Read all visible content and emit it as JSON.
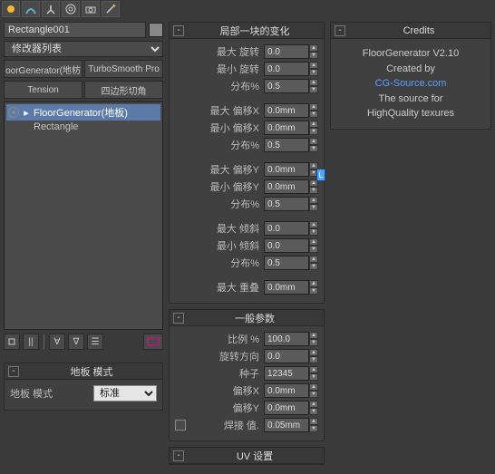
{
  "left": {
    "object_name": "Rectangle001",
    "modifier_list_label": "修改器列表",
    "tabs": [
      "oorGenerator(地枋",
      "TurboSmooth Pro",
      "Tension",
      "四边形切角"
    ],
    "stack": [
      {
        "label": "FloorGenerator(地板)",
        "selected": true,
        "eye": true
      },
      {
        "label": "Rectangle",
        "selected": false,
        "eye": false
      }
    ],
    "floor_mode_title": "地板 模式",
    "floor_mode_label": "地板 模式",
    "floor_mode_value": "标准"
  },
  "mid": {
    "rollout1": {
      "title": "局部一块的变化",
      "params": [
        {
          "label": "最大 旋转",
          "value": "0.0"
        },
        {
          "label": "最小 旋转",
          "value": "0.0"
        },
        {
          "label": "分布%",
          "value": "0.5"
        },
        {
          "gap": true
        },
        {
          "label": "最大 偏移X",
          "value": "0.0mm"
        },
        {
          "label": "最小 偏移X",
          "value": "0.0mm"
        },
        {
          "label": "分布%",
          "value": "0.5"
        },
        {
          "gap": true
        },
        {
          "label": "最大 偏移Y",
          "value": "0.0mm"
        },
        {
          "label": "最小 偏移Y",
          "value": "0.0mm"
        },
        {
          "label": "分布%",
          "value": "0.5"
        },
        {
          "gap": true
        },
        {
          "label": "最大 倾斜",
          "value": "0.0"
        },
        {
          "label": "最小 倾斜",
          "value": "0.0"
        },
        {
          "label": "分布%",
          "value": "0.5"
        },
        {
          "gap": true
        },
        {
          "label": "最大 重叠",
          "value": "0.0mm"
        }
      ]
    },
    "rollout2": {
      "title": "一般参数",
      "params": [
        {
          "label": "比例 %",
          "value": "100.0"
        },
        {
          "label": "旋转方向",
          "value": "0.0"
        },
        {
          "label": "种子",
          "value": "12345"
        },
        {
          "label": "偏移X",
          "value": "0.0mm"
        },
        {
          "label": "偏移Y",
          "value": "0.0mm"
        },
        {
          "label": "焊接 值.",
          "value": "0.05mm",
          "checkbox": true
        }
      ]
    },
    "rollout3": {
      "title": "UV 设置"
    }
  },
  "right": {
    "title": "Credits",
    "line1": "FloorGenerator V2.10",
    "line2": "Created by",
    "link_text": "CG-Source.com",
    "line3": "The source for",
    "line4": "HighQuality texures"
  },
  "lock_label": "L"
}
